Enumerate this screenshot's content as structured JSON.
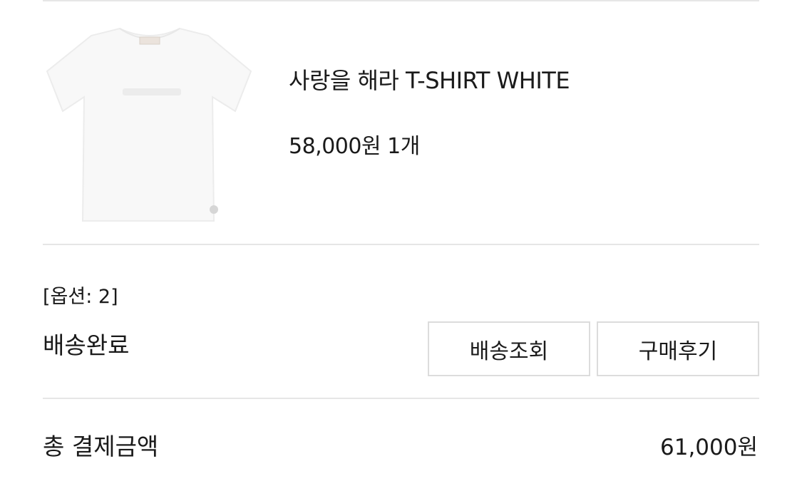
{
  "product": {
    "name": "사랑을 해라 T-SHIRT WHITE",
    "price": "58,000원",
    "quantity": "1개",
    "image_icon": "tshirt-image"
  },
  "order": {
    "option": "[옵션: 2]",
    "status": "배송완료"
  },
  "actions": {
    "track_label": "배송조회",
    "review_label": "구매후기"
  },
  "summary": {
    "total_label": "총 결제금액",
    "total_value": "61,000원"
  },
  "colors": {
    "divider": "#e6e6e6",
    "button_border": "#dcdcdc",
    "text": "#1a1a1a"
  }
}
